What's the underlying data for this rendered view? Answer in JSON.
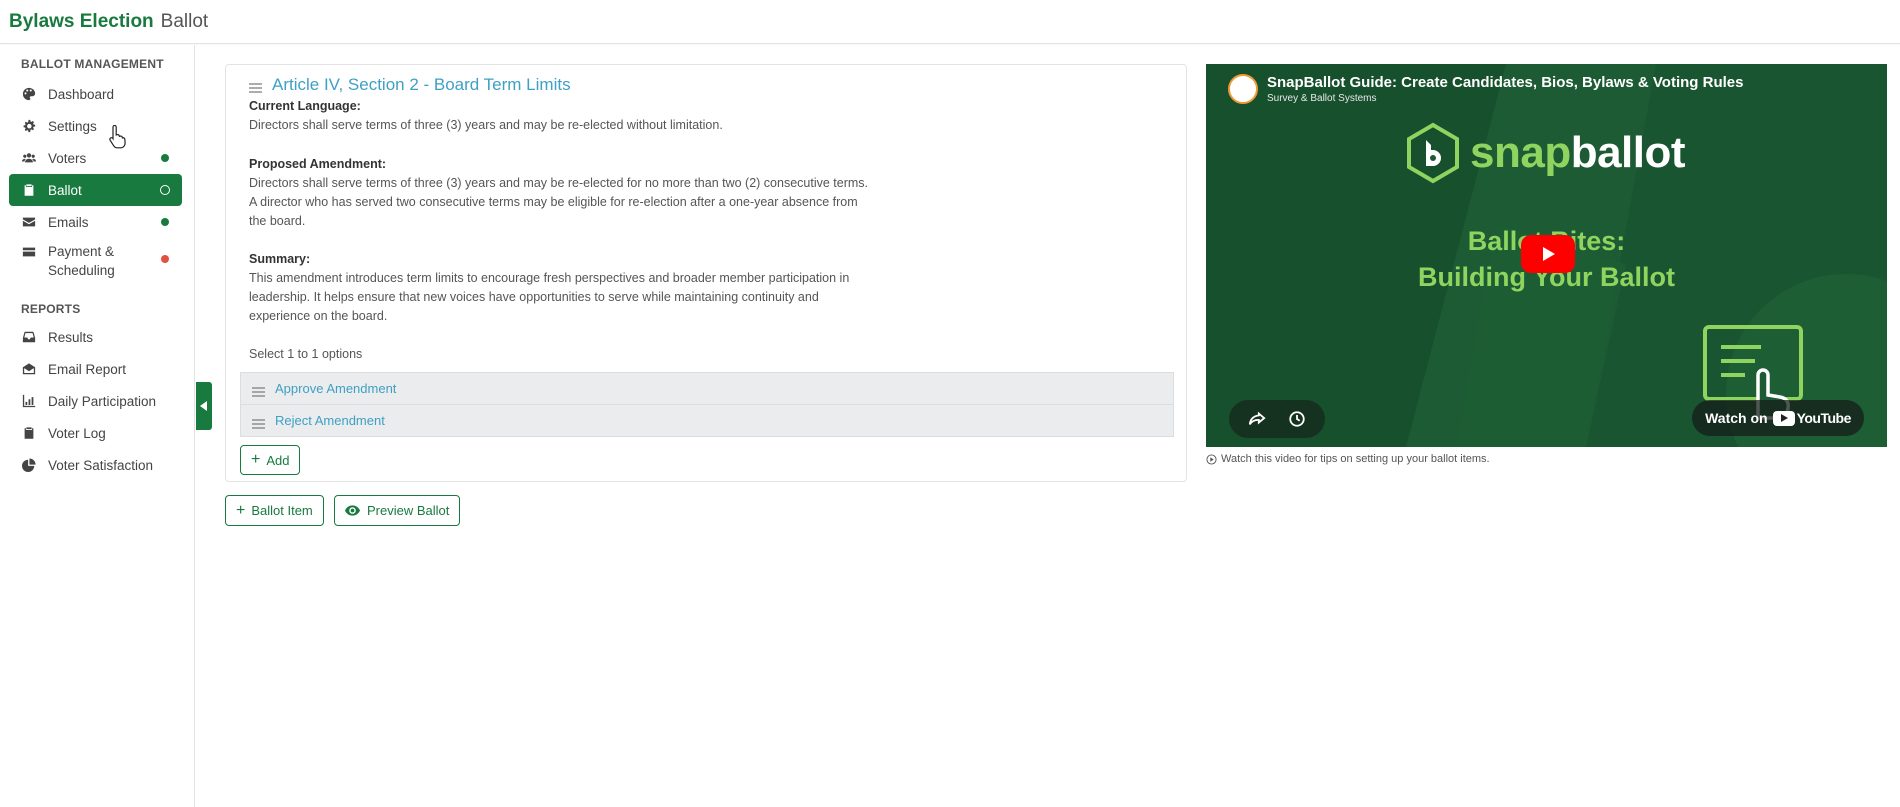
{
  "header": {
    "title": "Bylaws Election",
    "subtitle": "Ballot"
  },
  "sidebar": {
    "sections": [
      {
        "heading": "BALLOT MANAGEMENT",
        "items": [
          {
            "label": "Dashboard",
            "icon": "palette-icon",
            "status": ""
          },
          {
            "label": "Settings",
            "icon": "gear-icon",
            "status": ""
          },
          {
            "label": "Voters",
            "icon": "users-icon",
            "status": "complete"
          },
          {
            "label": "Ballot",
            "icon": "clipboard-icon",
            "status": "in-progress",
            "active": true
          },
          {
            "label": "Emails",
            "icon": "envelope-icon",
            "status": "complete"
          },
          {
            "label": "Payment & Scheduling",
            "icon": "credit-card-icon",
            "status": "incomplete"
          }
        ]
      },
      {
        "heading": "REPORTS",
        "items": [
          {
            "label": "Results",
            "icon": "inbox-icon"
          },
          {
            "label": "Email Report",
            "icon": "mail-report-icon"
          },
          {
            "label": "Daily Participation",
            "icon": "chart-icon"
          },
          {
            "label": "Voter Log",
            "icon": "clipboard-list-icon"
          },
          {
            "label": "Voter Satisfaction",
            "icon": "pie-icon"
          }
        ]
      }
    ]
  },
  "ballot_item": {
    "title": "Article IV, Section 2 - Board Term Limits",
    "current_heading": "Current Language:",
    "current_text": "Directors shall serve terms of three (3) years and may be re-elected without limitation.",
    "proposed_heading": "Proposed Amendment:",
    "proposed_text": "Directors shall serve terms of three (3) years and may be re-elected for no more than two (2) consecutive terms. A director who has served two consecutive terms may be eligible for re-election after a one-year absence from the board.",
    "summary_heading": "Summary:",
    "summary_text": "This amendment introduces term limits to encourage fresh perspectives and broader member participation in leadership. It helps ensure that new voices have opportunities to serve while maintaining continuity and experience on the board.",
    "select_note": "Select 1 to 1 options",
    "options": [
      "Approve Amendment",
      "Reject Amendment"
    ],
    "add_label": "Add"
  },
  "actions": {
    "ballot_item_label": "Ballot Item",
    "preview_label": "Preview Ballot"
  },
  "video": {
    "title": "SnapBallot Guide: Create Candidates, Bios, Bylaws & Voting Rules",
    "channel": "Survey & Ballot Systems",
    "logo_snap": "snap",
    "logo_ballot": "ballot",
    "headline_1": "Ballot Bites:",
    "headline_2": "Building Your Ballot",
    "watch_on": "Watch on",
    "youtube": "YouTube",
    "caption": "Watch this video for tips on setting up your ballot items."
  },
  "colors": {
    "brand_green": "#187a3f",
    "link_blue": "#3ea0c4",
    "status_red": "#e0513f",
    "snap_green": "#8ed45f"
  }
}
